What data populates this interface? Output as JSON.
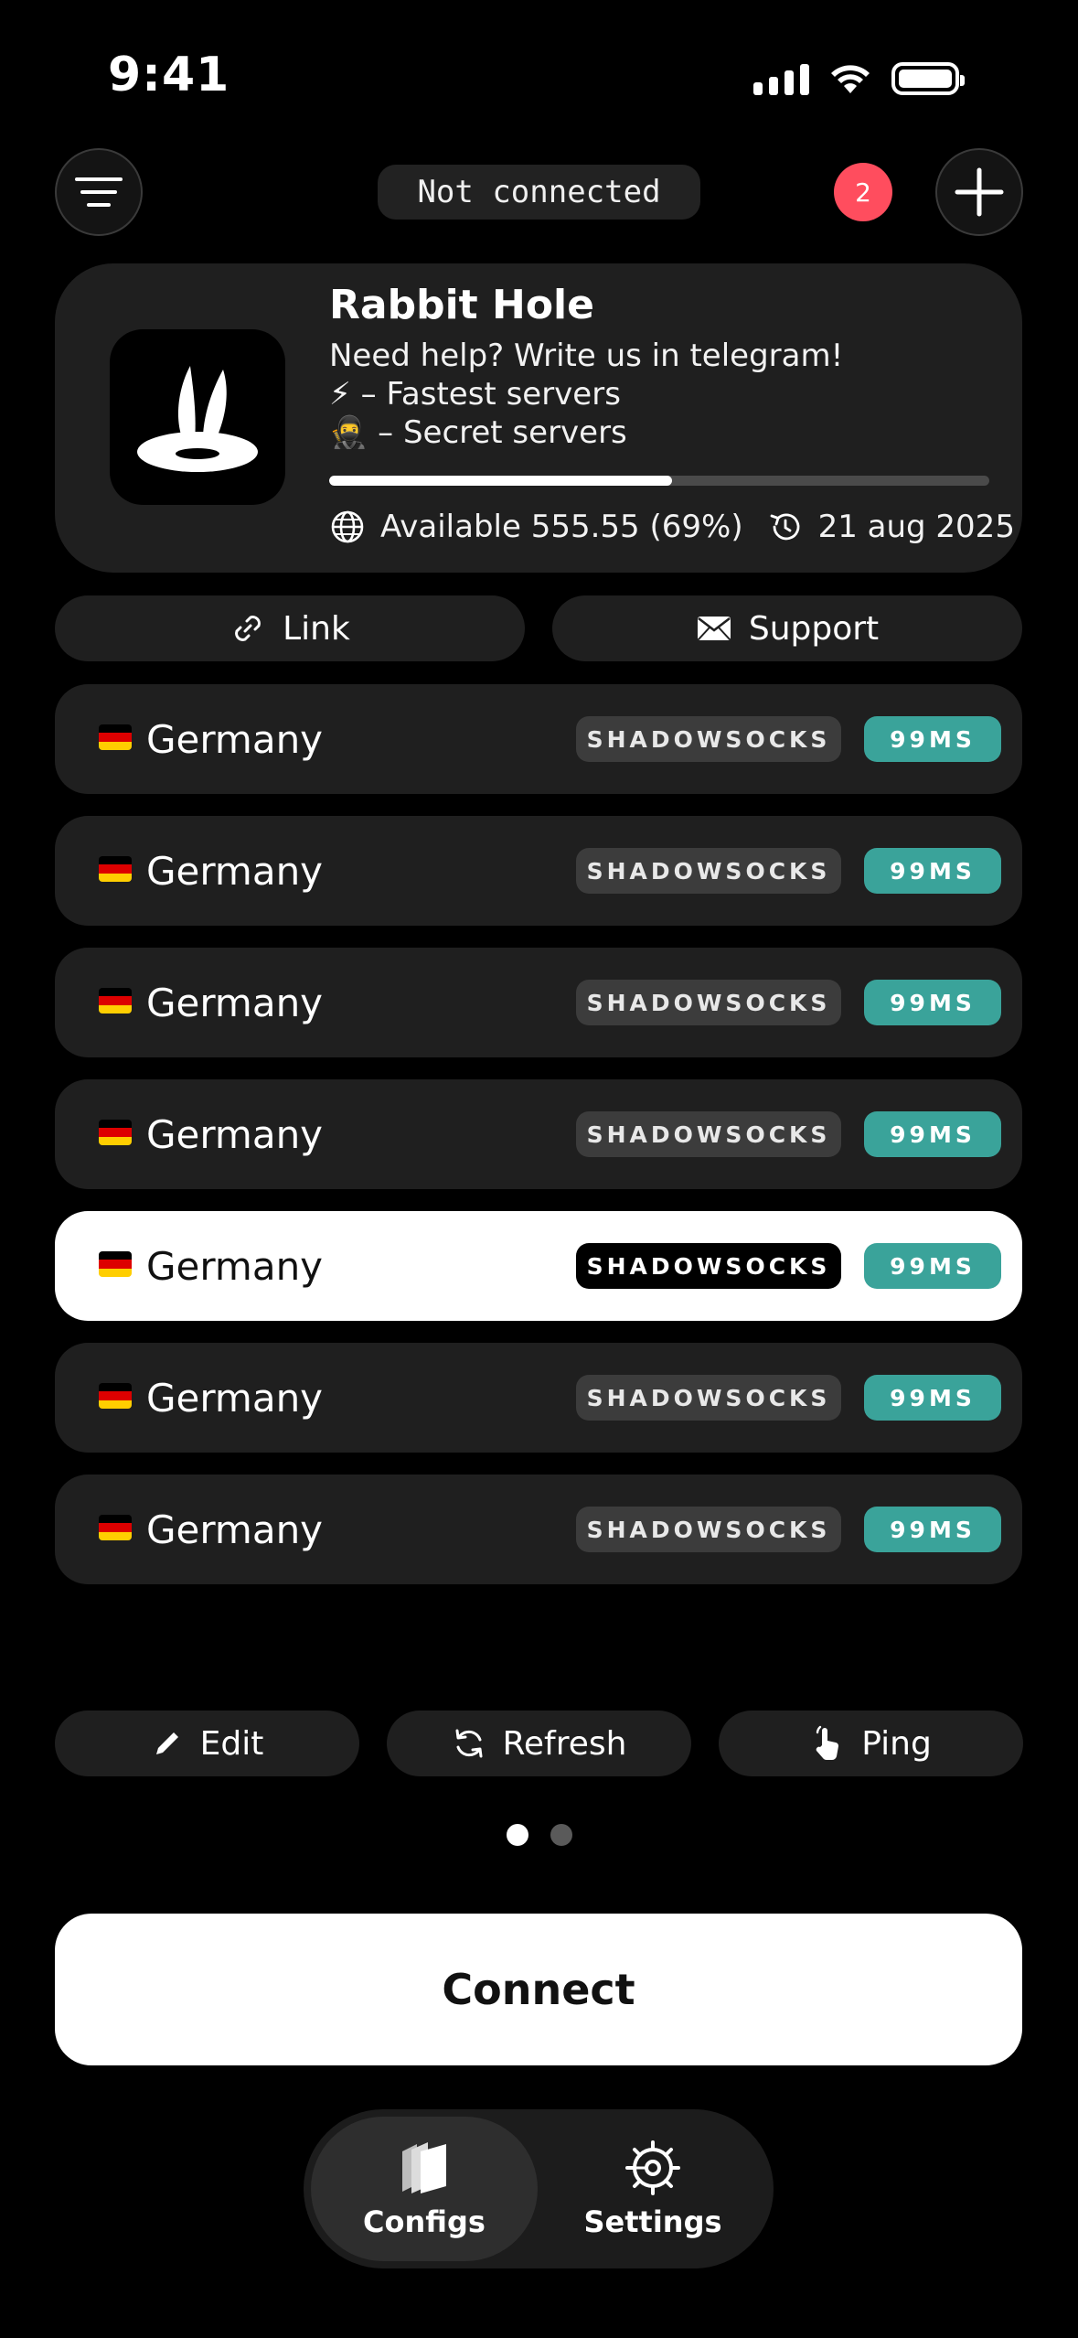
{
  "status_bar": {
    "time": "9:41"
  },
  "header": {
    "connection_status": "Not connected",
    "notification_count": "2"
  },
  "provider": {
    "name": "Rabbit Hole",
    "help_text": "Need help? Write us in telegram!",
    "fastest_line": "⚡ – Fastest servers",
    "secret_line": "🥷 – Secret servers",
    "usage_fraction": 0.52,
    "available_text": "Available 555.55 (69%)",
    "renew_date": "21 aug 2025"
  },
  "quick_actions": {
    "link_label": "Link",
    "support_label": "Support"
  },
  "servers": [
    {
      "name": "Germany",
      "protocol": "SHADOWSOCKS",
      "ping": "99MS",
      "selected": false
    },
    {
      "name": "Germany",
      "protocol": "SHADOWSOCKS",
      "ping": "99MS",
      "selected": false
    },
    {
      "name": "Germany",
      "protocol": "SHADOWSOCKS",
      "ping": "99MS",
      "selected": false
    },
    {
      "name": "Germany",
      "protocol": "SHADOWSOCKS",
      "ping": "99MS",
      "selected": false
    },
    {
      "name": "Germany",
      "protocol": "SHADOWSOCKS",
      "ping": "99MS",
      "selected": true
    },
    {
      "name": "Germany",
      "protocol": "SHADOWSOCKS",
      "ping": "99MS",
      "selected": false
    },
    {
      "name": "Germany",
      "protocol": "SHADOWSOCKS",
      "ping": "99MS",
      "selected": false
    }
  ],
  "actions": {
    "edit_label": "Edit",
    "refresh_label": "Refresh",
    "ping_label": "Ping"
  },
  "pager": {
    "current_page": 1,
    "page_count": 2
  },
  "connect_label": "Connect",
  "tabs": {
    "configs_label": "Configs",
    "settings_label": "Settings"
  },
  "colors": {
    "ping_badge": "#3aa39a",
    "notification_badge": "#ff4d5e"
  }
}
